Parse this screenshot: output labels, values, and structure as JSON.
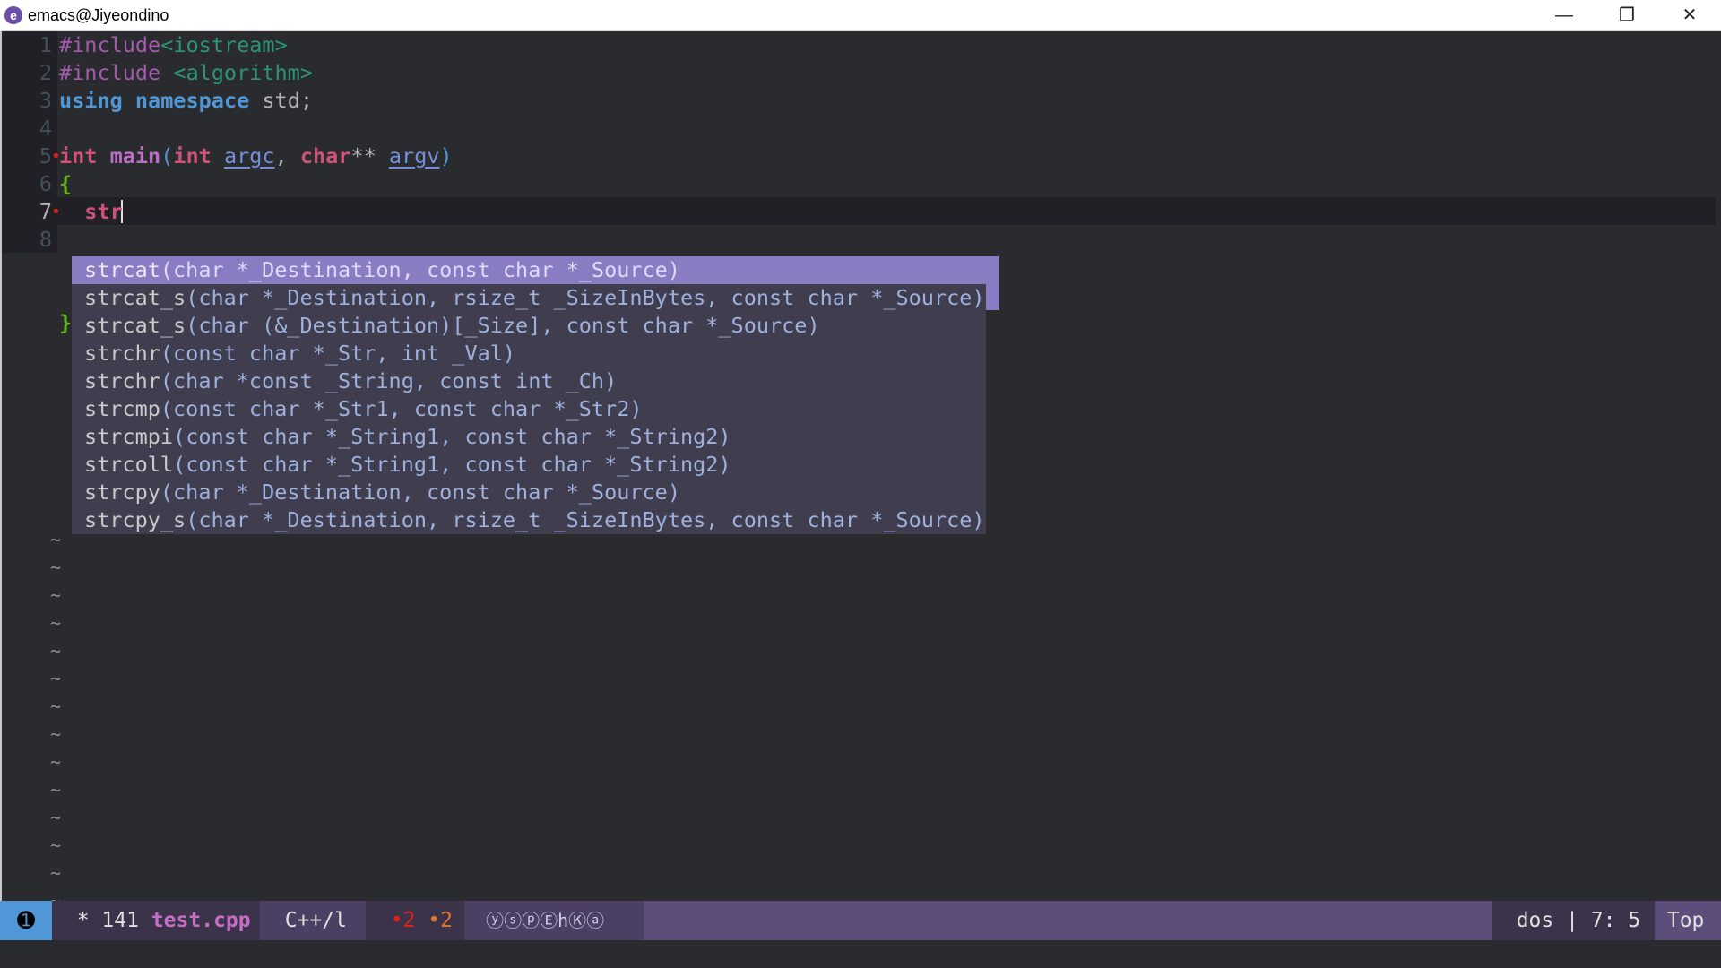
{
  "window": {
    "title": "emacs@Jiyeondino",
    "icon": "emacs-icon",
    "controls": {
      "minimize": "—",
      "maximize": "❐",
      "close": "✕"
    }
  },
  "editor": {
    "lines": [
      {
        "num": "1",
        "parts": [
          {
            "t": "#include",
            "c": "pp"
          },
          {
            "t": "<iostream>",
            "c": "str"
          }
        ]
      },
      {
        "num": "2",
        "parts": [
          {
            "t": "#include",
            "c": "pp"
          },
          {
            "t": " ",
            "c": "plain"
          },
          {
            "t": "<algorithm>",
            "c": "str"
          }
        ]
      },
      {
        "num": "3",
        "parts": [
          {
            "t": "using",
            "c": "kw"
          },
          {
            "t": " ",
            "c": "plain"
          },
          {
            "t": "namespace",
            "c": "kw"
          },
          {
            "t": " std;",
            "c": "plain"
          }
        ]
      },
      {
        "num": "4",
        "parts": []
      },
      {
        "num": "5",
        "marker": true,
        "parts": [
          {
            "t": "int",
            "c": "type"
          },
          {
            "t": " ",
            "c": "plain"
          },
          {
            "t": "main",
            "c": "func"
          },
          {
            "t": "(",
            "c": "brace"
          },
          {
            "t": "int",
            "c": "type"
          },
          {
            "t": " ",
            "c": "plain"
          },
          {
            "t": "argc",
            "c": "var"
          },
          {
            "t": ", ",
            "c": "plain"
          },
          {
            "t": "char",
            "c": "type"
          },
          {
            "t": "** ",
            "c": "plain"
          },
          {
            "t": "argv",
            "c": "var"
          },
          {
            "t": ")",
            "c": "brace"
          }
        ]
      },
      {
        "num": "6",
        "parts": [
          {
            "t": "{",
            "c": "brace6"
          }
        ]
      },
      {
        "num": "7",
        "marker": true,
        "current": true,
        "parts": [
          {
            "t": "  ",
            "c": "plain"
          },
          {
            "t": "str",
            "c": "typed"
          }
        ]
      },
      {
        "num": "8",
        "parts": []
      },
      {
        "num": "",
        "parts": []
      },
      {
        "num": "",
        "parts": []
      },
      {
        "num": "",
        "parts": [
          {
            "t": "}",
            "c": "brace6"
          }
        ]
      }
    ],
    "tilde": "~",
    "tilde_count": 14
  },
  "completion": {
    "items": [
      {
        "name": "strcat",
        "args": "(char *_Destination, const char *_Source)",
        "selected": true
      },
      {
        "name": "strcat_s",
        "args": "(char *_Destination, rsize_t _SizeInBytes, const char *_Source)"
      },
      {
        "name": "strcat_s",
        "args": "(char (&_Destination)[_Size], const char *_Source)"
      },
      {
        "name": "strchr",
        "args": "(const char *_Str, int _Val)"
      },
      {
        "name": "strchr",
        "args": "(char *const _String, const int _Ch)"
      },
      {
        "name": "strcmp",
        "args": "(const char *_Str1, const char *_Str2)"
      },
      {
        "name": "strcmpi",
        "args": "(const char *_String1, const char *_String2)"
      },
      {
        "name": "strcoll",
        "args": "(const char *_String1, const char *_String2)"
      },
      {
        "name": "strcpy",
        "args": "(char *_Destination, const char *_Source)"
      },
      {
        "name": "strcpy_s",
        "args": "(char *_Destination, rsize_t _SizeInBytes, const char *_Source)"
      }
    ]
  },
  "modeline": {
    "window_number": "➊",
    "modified": "*",
    "size": "141",
    "filename": "test.cpp",
    "major_mode": "C++/l",
    "errors": "•2",
    "warnings": "•2",
    "minor_modes": "ⓨⓢⓟⒺhⓀⓐ",
    "eol": "dos",
    "separator": "|",
    "position": "7: 5",
    "scroll": "Top"
  },
  "colors": {
    "background": "#292b2e",
    "modeline": "#5d4d7a",
    "selection": "#8a7cc2",
    "keyword": "#4f97d7",
    "type": "#ce537a"
  }
}
